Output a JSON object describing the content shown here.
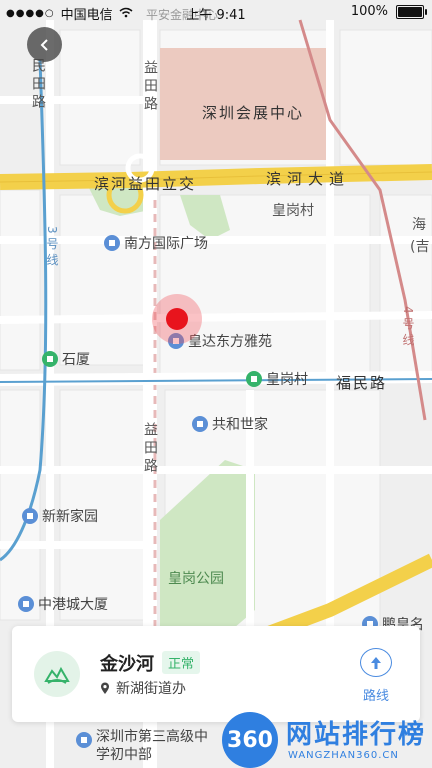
{
  "status_bar": {
    "signal": "●●●●○",
    "carrier": "中国电信",
    "wifi_icon": "wifi-icon",
    "time": "上午 9:41",
    "battery": "100%"
  },
  "map": {
    "road_labels": {
      "mintian_road": "民田路",
      "yitian_road_north": "益田路",
      "yitian_road_south": "益田路",
      "binhe_yitian_overpass": "滨河益田立交",
      "binhe_avenue": "滨河大道",
      "fumin_road": "福民路",
      "line3": "3号线",
      "line4": "4号线",
      "pingan": "平安金融中心"
    },
    "areas": {
      "convention_center": "深圳会展中心",
      "huanggang_village": "皇岗村",
      "huanggang_park": "皇岗公园",
      "hai": "海",
      "ji": "(吉"
    },
    "pois": {
      "nanfang_plaza": "南方国际广场",
      "huangda": "皇达东方雅苑",
      "shixia": "石厦",
      "huanggang_station": "皇岗村",
      "gonghe": "共和世家",
      "xinxin": "新新家园",
      "zhonggang": "中港城大厦",
      "school": "深圳市第三高级中学初中部",
      "pengsheng": "鹏皇名"
    }
  },
  "card": {
    "title": "金沙河",
    "status_badge": "正常",
    "location": "新湖街道办",
    "route_label": "路线"
  },
  "watermark": {
    "logo": "360",
    "title": "网站排行榜",
    "subtitle": "WANGZHAN360.CN"
  },
  "colors": {
    "main_road": "#f3d04a",
    "metro": "#5aa0d0",
    "green_area": "#cfe7c3",
    "convention_fill": "#eccac0",
    "accent": "#4a8be0",
    "status_green": "#35b36a",
    "pin_red": "#e8141d"
  }
}
